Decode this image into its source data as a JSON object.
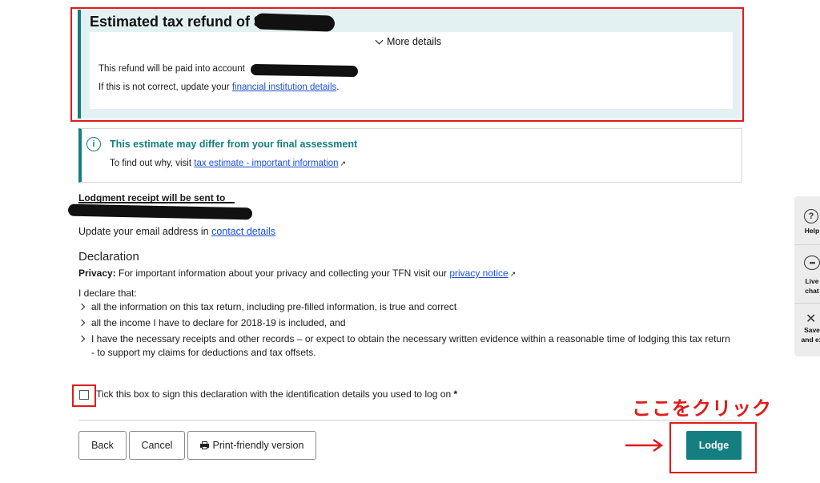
{
  "refund": {
    "title": "Estimated tax refund of $",
    "more_details": "More details",
    "account_line": "This refund will be paid into account",
    "correct_prefix": "If this is not correct, update your ",
    "correct_link": "financial institution details",
    "correct_suffix": "."
  },
  "estimate": {
    "title": "This estimate may differ from your final assessment",
    "text_prefix": "To find out why, visit ",
    "link": "tax estimate - important information"
  },
  "receipt": {
    "label": "Lodgment receipt will be sent to",
    "update_prefix": "Update your email address in ",
    "update_link": "contact details"
  },
  "declaration": {
    "heading": "Declaration",
    "privacy_label": "Privacy:",
    "privacy_text": " For important information about your privacy and collecting your TFN visit our ",
    "privacy_link": "privacy notice",
    "intro": "I declare that:",
    "items": [
      "all the information on this tax return, including pre-filled information, is true and correct",
      "all the income I have to declare for 2018-19 is included, and",
      "I have the necessary receipts and other records – or expect to obtain the necessary written evidence within a reasonable time of lodging this tax return - to support my claims for deductions and tax offsets."
    ],
    "checkbox_label": "Tick this box to sign this declaration with the identification details you used to log on",
    "required_mark": "*"
  },
  "buttons": {
    "back": "Back",
    "cancel": "Cancel",
    "print": "Print-friendly version",
    "lodge": "Lodge"
  },
  "annotation": {
    "text": "ここをクリック",
    "color": "#e01b1b"
  },
  "side_widget": {
    "help": "Help",
    "live_chat_1": "Live",
    "live_chat_2": "chat",
    "save_1": "Save",
    "save_2": "and ex"
  },
  "colors": {
    "accent": "#157e80",
    "link": "#1a4fd6",
    "highlight": "#e01b1b"
  },
  "icons": [
    "chevron-down-icon",
    "info-icon",
    "external-link-icon",
    "chevron-right-icon",
    "printer-icon",
    "question-icon",
    "chat-icon",
    "close-icon",
    "arrow-right-icon"
  ]
}
